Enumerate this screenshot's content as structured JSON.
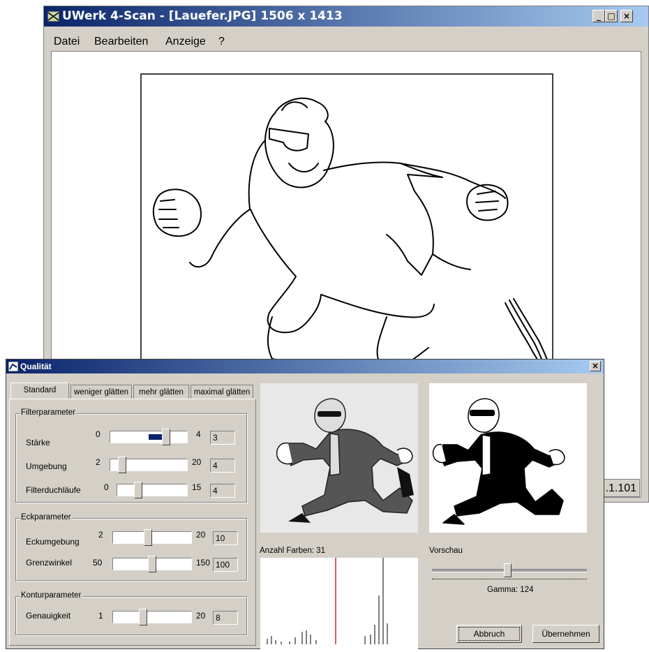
{
  "main_window": {
    "title": "UWerk 4-Scan - [Lauefer.JPG] 1506 x 1413",
    "buttons": {
      "minimize": "_",
      "maximize": "□",
      "close": "×"
    },
    "menu": [
      "Datei",
      "Bearbeiten",
      "Anzeige",
      "?"
    ],
    "status_text": ".1.101"
  },
  "dialog": {
    "title": "Qualität",
    "close": "×",
    "tabs": [
      "Standard",
      "weniger glätten",
      "mehr glätten",
      "maximal glätten"
    ],
    "active_tab": "Standard",
    "filter": {
      "group_label": "Filterparameter",
      "rows": [
        {
          "label": "Stärke",
          "min": "0",
          "max": "4",
          "value": "3",
          "level": 0.75
        },
        {
          "label": "Umgebung",
          "min": "2",
          "max": "20",
          "value": "4",
          "level": 0.11
        },
        {
          "label": "Filterduchläufe",
          "min": "0",
          "max": "15",
          "value": "4",
          "level": 0.27
        }
      ]
    },
    "eck": {
      "group_label": "Eckparameter",
      "rows": [
        {
          "label": "Eckumgebung",
          "min": "2",
          "max": "20",
          "value": "10",
          "level": 0.44
        },
        {
          "label": "Grenzwinkel",
          "min": "50",
          "max": "150",
          "value": "100",
          "level": 0.5
        }
      ]
    },
    "kontur": {
      "group_label": "Konturparameter",
      "rows": [
        {
          "label": "Genauigkeit",
          "min": "1",
          "max": "20",
          "value": "8",
          "level": 0.37
        }
      ]
    },
    "anzahl_farben": "Anzahl Farben: 31",
    "vorschau": "Vorschau",
    "gamma": "Gamma: 124",
    "gamma_level": 0.49,
    "abbruch": "Abbruch",
    "uebernehmen": "Übernehmen"
  }
}
